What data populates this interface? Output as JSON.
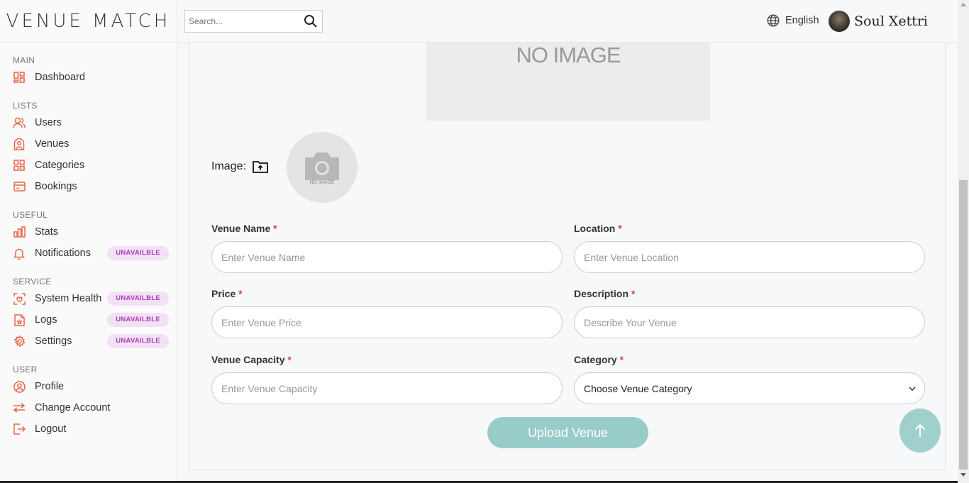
{
  "brand": {
    "logo_text": "VENUE MATCH"
  },
  "header": {
    "search_placeholder": "Search...",
    "language": "English",
    "user_name": "Soul Xettri"
  },
  "sidebar": {
    "sections": [
      {
        "title": "MAIN",
        "items": [
          {
            "label": "Dashboard",
            "icon": "dashboard-icon"
          }
        ]
      },
      {
        "title": "LISTS",
        "items": [
          {
            "label": "Users",
            "icon": "users-icon"
          },
          {
            "label": "Venues",
            "icon": "venue-icon"
          },
          {
            "label": "Categories",
            "icon": "categories-icon"
          },
          {
            "label": "Bookings",
            "icon": "bookings-icon"
          }
        ]
      },
      {
        "title": "USEFUL",
        "items": [
          {
            "label": "Stats",
            "icon": "stats-icon"
          },
          {
            "label": "Notifications",
            "icon": "bell-icon",
            "badge": "UNAVAILBLE"
          }
        ]
      },
      {
        "title": "SERVICE",
        "items": [
          {
            "label": "System Health",
            "icon": "health-icon",
            "badge": "UNAVAILBLE"
          },
          {
            "label": "Logs",
            "icon": "logs-icon",
            "badge": "UNAVAILBLE"
          },
          {
            "label": "Settings",
            "icon": "gear-icon",
            "badge": "UNAVAILBLE"
          }
        ]
      },
      {
        "title": "USER",
        "items": [
          {
            "label": "Profile",
            "icon": "profile-icon"
          },
          {
            "label": "Change Account",
            "icon": "swap-icon"
          },
          {
            "label": "Logout",
            "icon": "logout-icon"
          }
        ]
      }
    ]
  },
  "form": {
    "preview_text": "NO IMAGE",
    "image_label": "Image:",
    "avatar_placeholder": "NO IMAGE",
    "venue_name": {
      "label": "Venue Name",
      "required": "*",
      "placeholder": "Enter Venue Name"
    },
    "location": {
      "label": "Location",
      "required": "*",
      "placeholder": "Enter Venue Location"
    },
    "price": {
      "label": "Price",
      "required": "*",
      "placeholder": "Enter Venue Price"
    },
    "description": {
      "label": "Description",
      "required": "*",
      "placeholder": "Describe Your Venue"
    },
    "capacity": {
      "label": "Venue Capacity",
      "required": "*",
      "placeholder": "Enter Venue Capacity"
    },
    "category": {
      "label": "Category",
      "required": "*",
      "selected": "Choose Venue Category"
    },
    "submit_label": "Upload Venue"
  },
  "colors": {
    "accent": "#e8664a",
    "badge_bg": "#f3e1f5",
    "badge_text": "#a93ab8",
    "button_bg": "#98ccc8",
    "required": "#e0403c"
  }
}
